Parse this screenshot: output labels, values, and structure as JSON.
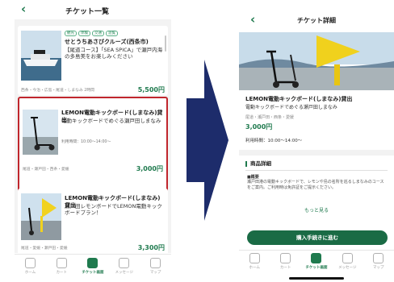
{
  "left": {
    "header": {
      "title": "チケット一覧",
      "back_icon": "chevron-left-icon"
    },
    "cards": [
      {
        "tags": [
          "観光",
          "体験",
          "交通",
          "遊覧"
        ],
        "title": "せとうちあさびクルーズ(西条市)",
        "desc": "【尾道コース】「SEA SPICA」で瀬戸内海の多島美をお楽しみください",
        "meta": "西条・今治・広島・尾道・しまなみ 2時間",
        "price": "5,500円"
      },
      {
        "title": "LEMON電動キックボード(しまなみ)貸出",
        "desc": "電動キックボードでめぐる瀬戸田しまなみ",
        "hours": "利用時間：10:00〜14:00〜",
        "meta": "尾道・瀬戸田・西条・愛媛",
        "price": "3,000円",
        "highlighted": true
      },
      {
        "title": "LEMON電動キックボード(しまなみ)貸出",
        "desc": "瀬戸田レモンボードでLEMON電動キックボードプラン！",
        "meta": "尾道・愛媛・瀬戸田・愛媛",
        "price": "3,300円"
      }
    ],
    "tabs": [
      {
        "label": "ホーム",
        "icon": "home-icon"
      },
      {
        "label": "カート",
        "icon": "cart-icon"
      },
      {
        "label": "チケット画面",
        "icon": "ticket-icon",
        "active": true
      },
      {
        "label": "メッセージ",
        "icon": "message-icon"
      },
      {
        "label": "マップ",
        "icon": "map-icon"
      }
    ]
  },
  "right": {
    "header": {
      "title": "チケット詳細",
      "back_icon": "chevron-left-icon"
    },
    "name": "LEMON電動キックボード(しまなみ)貸出",
    "sub": "電動キックボードでめぐる瀬戸田しまなみ",
    "meta": "尾道・瀬戸田・西条・愛媛",
    "price": "3,000円",
    "hours": "利用時間：10:00〜14:00〜",
    "section_title": "商品詳細",
    "body_label": "■概要",
    "body": "瀬戸田港の電動キックボードで、レモンや島の名所を巡るしまなみのコースをご案内。ご利用時は免許証をご提示ください。",
    "more_label": "もっと見る",
    "cta_label": "購入手続きに進む",
    "tabs": [
      {
        "label": "ホーム",
        "icon": "home-icon"
      },
      {
        "label": "カート",
        "icon": "cart-icon"
      },
      {
        "label": "チケット画面",
        "icon": "ticket-icon",
        "active": true
      },
      {
        "label": "メッセージ",
        "icon": "message-icon"
      },
      {
        "label": "マップ",
        "icon": "map-icon"
      }
    ]
  },
  "colors": {
    "accent": "#1f7a4e",
    "highlight": "#c0262d",
    "arrow": "#1d2c6b"
  }
}
